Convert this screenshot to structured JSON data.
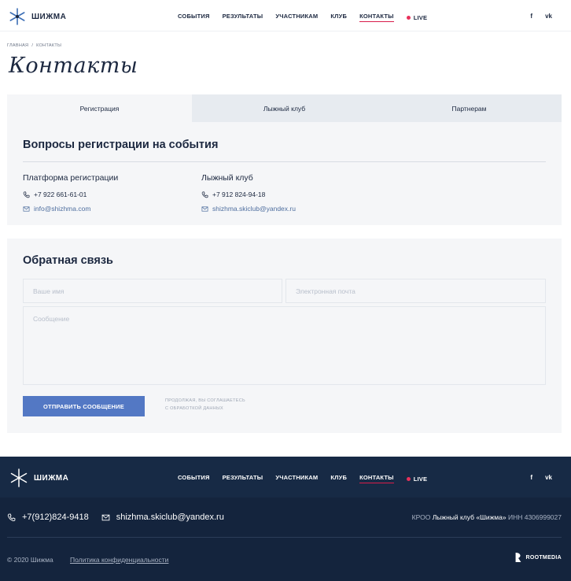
{
  "header": {
    "logo_text": "ШИЖМА",
    "nav": [
      "СОБЫТИЯ",
      "РЕЗУЛЬТАТЫ",
      "УЧАСТНИКАМ",
      "КЛУБ",
      "КОНТАКТЫ",
      "LIVE"
    ],
    "social": [
      "f",
      "vk"
    ]
  },
  "breadcrumb": [
    "ГЛАВНАЯ",
    "/",
    "КОНТАКТЫ"
  ],
  "page_title": "Контакты",
  "tabs": [
    "Регистрация",
    "Лыжный клуб",
    "Партнерам"
  ],
  "registration": {
    "title": "Вопросы регистрации на события",
    "columns": [
      {
        "title": "Платформа регистрации",
        "phone": "+7 922 661-61-01",
        "email": "info@shizhma.com"
      },
      {
        "title": "Лыжный клуб",
        "phone": "+7 912 824-94-18",
        "email": "shizhma.skiclub@yandex.ru"
      }
    ]
  },
  "feedback": {
    "title": "Обратная связь",
    "name_placeholder": "Ваше имя",
    "email_placeholder": "Электронная почта",
    "message_placeholder": "Сообщение",
    "send_label": "ОТПРАВИТЬ СООБЩЕНИЕ",
    "consent_line1": "ПРОДОЛЖАЯ, ВЫ СОГЛАШАЕТЕСЬ",
    "consent_line2": "С ОБРАБОТКОЙ ДАННЫХ"
  },
  "footer": {
    "logo_text": "ШИЖМА",
    "nav": [
      "СОБЫТИЯ",
      "РЕЗУЛЬТАТЫ",
      "УЧАСТНИКАМ",
      "КЛУБ",
      "КОНТАКТЫ",
      "LIVE"
    ],
    "social": [
      "f",
      "vk"
    ],
    "phone": "+7(912)824-9418",
    "email": "shizhma.skiclub@yandex.ru",
    "org_prefix": "КРОО",
    "org_name": "Лыжный клуб «Шижма»",
    "org_inn": "ИНН 4306999027",
    "copyright": "© 2020 Шижма",
    "policy": "Политика конфиденциальности",
    "developer": "ROOTMEDIA"
  },
  "colors": {
    "accent": "#5378c4",
    "live": "#e8315b",
    "footer_bg": "#14243d",
    "panel_bg": "#f5f6f8"
  }
}
